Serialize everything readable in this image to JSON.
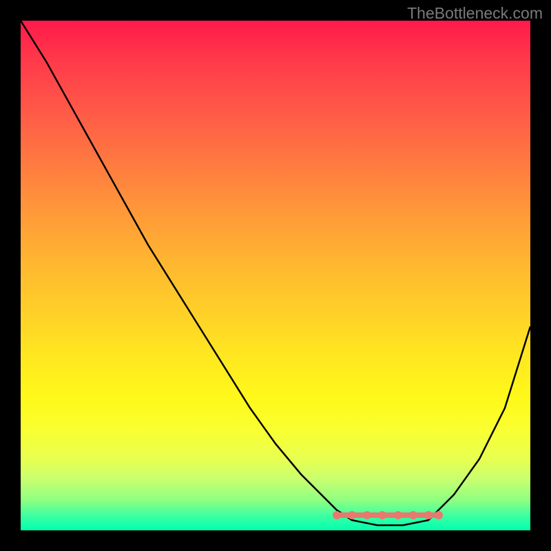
{
  "watermark": "TheBottleneck.com",
  "chart_data": {
    "type": "line",
    "title": "",
    "xlabel": "",
    "ylabel": "",
    "xlim": [
      0,
      100
    ],
    "ylim": [
      0,
      100
    ],
    "series": [
      {
        "name": "curve",
        "x": [
          0,
          5,
          10,
          15,
          20,
          25,
          30,
          35,
          40,
          45,
          50,
          55,
          60,
          62,
          65,
          70,
          75,
          80,
          82,
          85,
          90,
          95,
          100
        ],
        "y": [
          100,
          92,
          83,
          74,
          65,
          56,
          48,
          40,
          32,
          24,
          17,
          11,
          6,
          4,
          2,
          1,
          1,
          2,
          4,
          7,
          14,
          24,
          40
        ],
        "color": "#000000"
      }
    ],
    "markers": {
      "color": "#e8796f",
      "start_x": 62,
      "end_x": 82,
      "y": 3,
      "points_x": [
        62,
        65,
        68,
        71,
        74,
        77,
        80,
        82
      ]
    },
    "gradient_background": {
      "top_color": "#ff1a4a",
      "bottom_color": "#00ffb0"
    }
  }
}
